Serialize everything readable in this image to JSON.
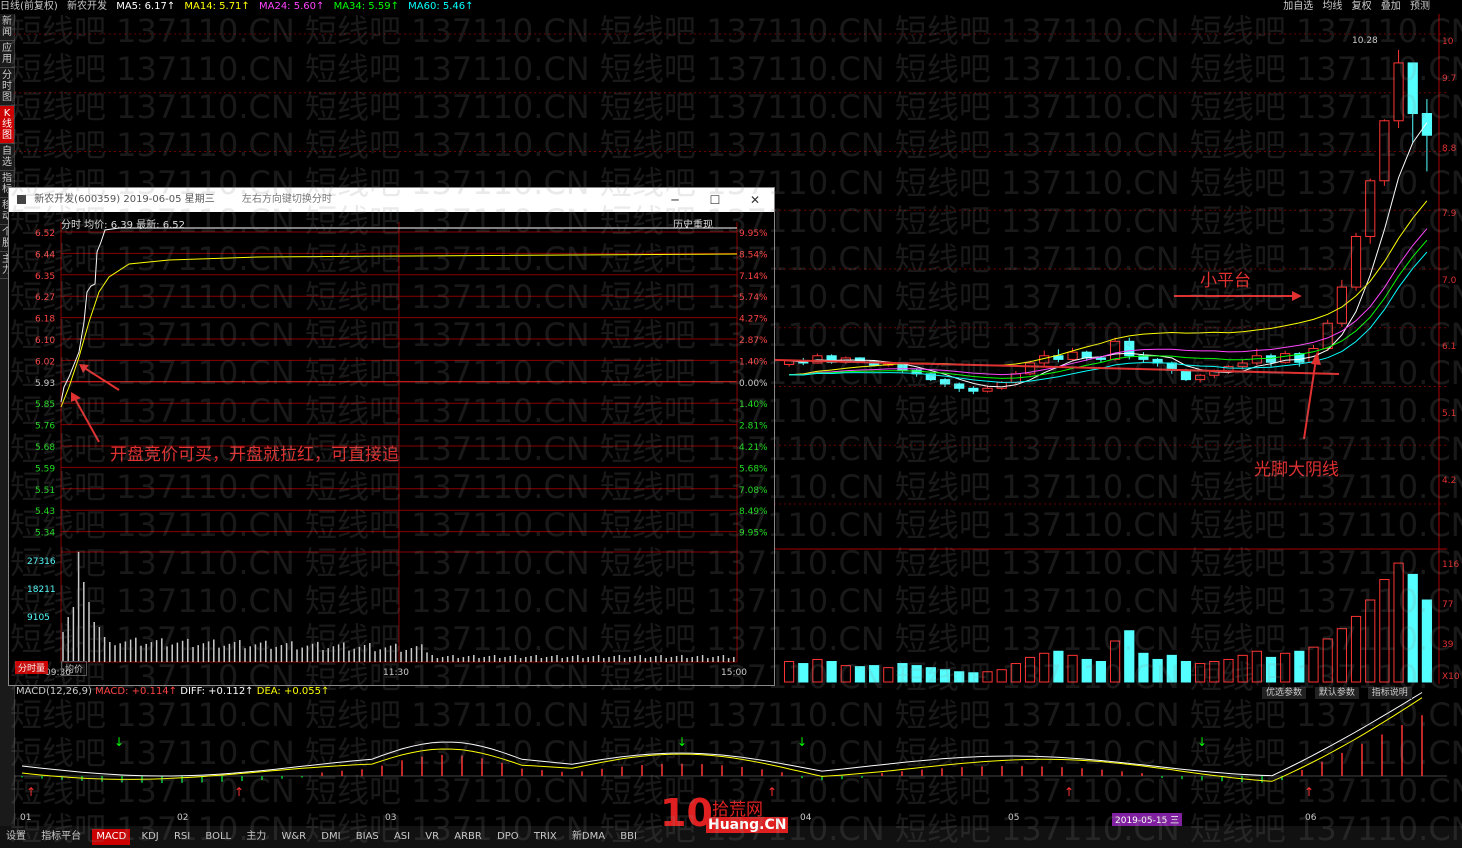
{
  "topbar": {
    "chart_title": "日线(前复权)",
    "stock_name": "新农开发",
    "ma5": "MA5: 6.17↑",
    "ma14": "MA14: 5.71↑",
    "ma24": "MA24: 5.60↑",
    "ma34": "MA34: 5.59↑",
    "ma60": "MA60: 5.46↑",
    "right_items": [
      "加自选",
      "均线",
      "复权",
      "叠加",
      "预测"
    ],
    "colors": {
      "ma5": "#ffffff",
      "ma14": "#ffff00",
      "ma24": "#ff00ff",
      "ma34": "#00ff00",
      "ma60": "#00ffff"
    }
  },
  "left_nav": [
    "新闻",
    "应用",
    "分时图",
    "K线图",
    "自选",
    "指标",
    "移动",
    "个股",
    "主力"
  ],
  "right_axis": {
    "price_labels": [
      "10.28",
      "10",
      "9.7",
      "8.8",
      "7.9",
      "7.0",
      "6.1",
      "5.1",
      "4.2"
    ],
    "vol_labels": [
      "116",
      "77",
      "39",
      "X10"
    ]
  },
  "kline": {
    "candles": [
      {
        "o": 5.93,
        "c": 5.98,
        "h": 6.0,
        "l": 5.9,
        "v": 20
      },
      {
        "o": 5.98,
        "c": 5.95,
        "h": 6.02,
        "l": 5.92,
        "v": 18
      },
      {
        "o": 5.95,
        "c": 6.05,
        "h": 6.08,
        "l": 5.94,
        "v": 22
      },
      {
        "o": 6.05,
        "c": 5.96,
        "h": 6.07,
        "l": 5.94,
        "v": 20
      },
      {
        "o": 5.96,
        "c": 6.02,
        "h": 6.04,
        "l": 5.94,
        "v": 16
      },
      {
        "o": 6.02,
        "c": 5.97,
        "h": 6.03,
        "l": 5.95,
        "v": 15
      },
      {
        "o": 5.97,
        "c": 5.92,
        "h": 5.99,
        "l": 5.9,
        "v": 16
      },
      {
        "o": 5.92,
        "c": 5.94,
        "h": 5.96,
        "l": 5.9,
        "v": 14
      },
      {
        "o": 5.94,
        "c": 5.85,
        "h": 5.95,
        "l": 5.82,
        "v": 18
      },
      {
        "o": 5.85,
        "c": 5.8,
        "h": 5.87,
        "l": 5.76,
        "v": 16
      },
      {
        "o": 5.8,
        "c": 5.72,
        "h": 5.82,
        "l": 5.7,
        "v": 14
      },
      {
        "o": 5.72,
        "c": 5.66,
        "h": 5.74,
        "l": 5.62,
        "v": 12
      },
      {
        "o": 5.66,
        "c": 5.6,
        "h": 5.68,
        "l": 5.55,
        "v": 10
      },
      {
        "o": 5.6,
        "c": 5.56,
        "h": 5.63,
        "l": 5.52,
        "v": 9
      },
      {
        "o": 5.56,
        "c": 5.6,
        "h": 5.64,
        "l": 5.54,
        "v": 10
      },
      {
        "o": 5.6,
        "c": 5.68,
        "h": 5.7,
        "l": 5.58,
        "v": 12
      },
      {
        "o": 5.68,
        "c": 5.8,
        "h": 5.84,
        "l": 5.66,
        "v": 18
      },
      {
        "o": 5.8,
        "c": 5.95,
        "h": 5.98,
        "l": 5.78,
        "v": 24
      },
      {
        "o": 5.95,
        "c": 6.05,
        "h": 6.12,
        "l": 5.9,
        "v": 28
      },
      {
        "o": 6.05,
        "c": 6.0,
        "h": 6.14,
        "l": 5.96,
        "v": 30
      },
      {
        "o": 6.0,
        "c": 6.1,
        "h": 6.16,
        "l": 5.97,
        "v": 26
      },
      {
        "o": 6.1,
        "c": 6.02,
        "h": 6.12,
        "l": 5.98,
        "v": 22
      },
      {
        "o": 6.02,
        "c": 6.0,
        "h": 6.05,
        "l": 5.96,
        "v": 20
      },
      {
        "o": 6.0,
        "c": 6.25,
        "h": 6.3,
        "l": 5.98,
        "v": 40
      },
      {
        "o": 6.25,
        "c": 6.05,
        "h": 6.3,
        "l": 6.0,
        "v": 50
      },
      {
        "o": 6.05,
        "c": 6.0,
        "h": 6.1,
        "l": 5.95,
        "v": 28
      },
      {
        "o": 6.0,
        "c": 5.95,
        "h": 6.02,
        "l": 5.9,
        "v": 22
      },
      {
        "o": 5.95,
        "c": 5.85,
        "h": 5.97,
        "l": 5.8,
        "v": 26
      },
      {
        "o": 5.85,
        "c": 5.72,
        "h": 5.87,
        "l": 5.7,
        "v": 20
      },
      {
        "o": 5.72,
        "c": 5.78,
        "h": 5.8,
        "l": 5.68,
        "v": 18
      },
      {
        "o": 5.78,
        "c": 5.84,
        "h": 5.86,
        "l": 5.74,
        "v": 20
      },
      {
        "o": 5.84,
        "c": 5.9,
        "h": 5.92,
        "l": 5.8,
        "v": 22
      },
      {
        "o": 5.9,
        "c": 5.95,
        "h": 6.0,
        "l": 5.86,
        "v": 26
      },
      {
        "o": 5.95,
        "c": 6.05,
        "h": 6.15,
        "l": 5.92,
        "v": 30
      },
      {
        "o": 6.05,
        "c": 5.96,
        "h": 6.08,
        "l": 5.9,
        "v": 24
      },
      {
        "o": 5.96,
        "c": 6.08,
        "h": 6.12,
        "l": 5.94,
        "v": 28
      },
      {
        "o": 6.08,
        "c": 5.96,
        "h": 6.1,
        "l": 5.9,
        "v": 30
      },
      {
        "o": 5.96,
        "c": 6.15,
        "h": 6.2,
        "l": 5.94,
        "v": 34
      },
      {
        "o": 6.15,
        "c": 6.5,
        "h": 6.55,
        "l": 6.12,
        "v": 42
      },
      {
        "o": 6.5,
        "c": 7.0,
        "h": 7.1,
        "l": 6.45,
        "v": 52
      },
      {
        "o": 7.0,
        "c": 7.7,
        "h": 7.75,
        "l": 6.95,
        "v": 64
      },
      {
        "o": 7.7,
        "c": 8.47,
        "h": 8.5,
        "l": 7.6,
        "v": 80
      },
      {
        "o": 8.47,
        "c": 9.3,
        "h": 9.32,
        "l": 8.4,
        "v": 100
      },
      {
        "o": 9.3,
        "c": 10.1,
        "h": 10.28,
        "l": 9.2,
        "v": 116
      },
      {
        "o": 10.1,
        "c": 9.4,
        "h": 10.1,
        "l": 9.0,
        "v": 105
      },
      {
        "o": 9.4,
        "c": 9.1,
        "h": 9.6,
        "l": 8.6,
        "v": 80
      }
    ],
    "price_min": 4.0,
    "price_max": 10.5,
    "vol_max": 120
  },
  "macd": {
    "header": "MACD(12,26,9)",
    "macd_val": "MACD: +0.114↑",
    "diff_val": "DIFF: +0.112↑",
    "dea_val": "DEA: +0.055↑",
    "buttons": [
      "优选参数",
      "默认参数",
      "指标说明"
    ],
    "date_badge": "2019-05-15 三",
    "month_labels": [
      "01",
      "02",
      "03",
      "04",
      "05",
      "06"
    ]
  },
  "popup": {
    "title": "新农开发(600359) 2019-06-05 星期三",
    "hint": "左右方向键切换分时",
    "header": "分时 均价: 6.39 最新: 6.52",
    "history_btn": "历史重现",
    "price_labels": [
      "6.52",
      "6.44",
      "6.35",
      "6.27",
      "6.18",
      "6.10",
      "6.02",
      "5.93",
      "5.85",
      "5.76",
      "5.68",
      "5.59",
      "5.51",
      "5.43",
      "5.34"
    ],
    "pct_labels": [
      "9.95%",
      "8.54%",
      "7.14%",
      "5.74%",
      "4.27%",
      "2.87%",
      "1.40%",
      "0.00%",
      "1.40%",
      "2.81%",
      "4.21%",
      "5.68%",
      "7.08%",
      "8.49%",
      "9.95%"
    ],
    "vol_labels": [
      "27316",
      "18211",
      "9105"
    ],
    "time_labels": [
      "09:30",
      "11:30",
      "15:00"
    ],
    "tabs": [
      "分时量",
      "均价"
    ]
  },
  "annotations": {
    "open_note": "开盘竞价可买，开盘就拉红，可直接追",
    "platform": "小平台",
    "big_yin": "光脚大阴线"
  },
  "bottom_tabs": [
    "设置",
    "指标平台",
    "MACD",
    "KDJ",
    "RSI",
    "BOLL",
    "主力",
    "W&R",
    "DMI",
    "BIAS",
    "ASI",
    "VR",
    "ARBR",
    "DPO",
    "TRIX",
    "新DMA",
    "BBI"
  ],
  "logo": {
    "brand": "10",
    "name": "拾荒网",
    "url": "Huang.CN"
  },
  "watermark_text": "短线吧 137110.CN 短线吧 137110.CN 短线吧 137110.CN 短线吧 137110.CN 短线吧 137110.CN 短线吧 137110.CN"
}
